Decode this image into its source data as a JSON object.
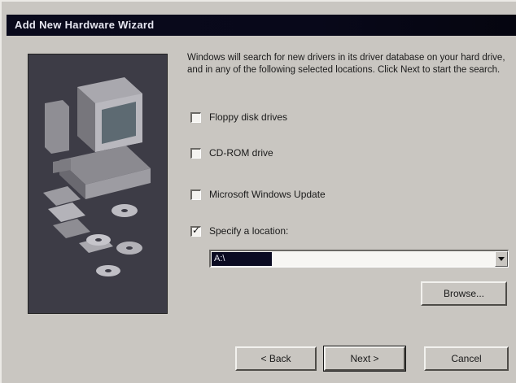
{
  "window": {
    "title": "Add New Hardware Wizard"
  },
  "intro_text": "Windows will search for new drivers in its driver database on your hard drive, and in any of the following selected locations. Click Next to start the search.",
  "options": [
    {
      "label": "Floppy disk drives",
      "checked": false
    },
    {
      "label": "CD-ROM drive",
      "checked": false
    },
    {
      "label": "Microsoft Windows Update",
      "checked": false
    },
    {
      "label": "Specify a location:",
      "checked": true
    }
  ],
  "location": {
    "value": "A:\\"
  },
  "buttons": {
    "browse": "Browse...",
    "back": "< Back",
    "next": "Next >",
    "cancel": "Cancel"
  },
  "icons": [
    "computer-icon",
    "disk-icon",
    "cd-icon"
  ]
}
